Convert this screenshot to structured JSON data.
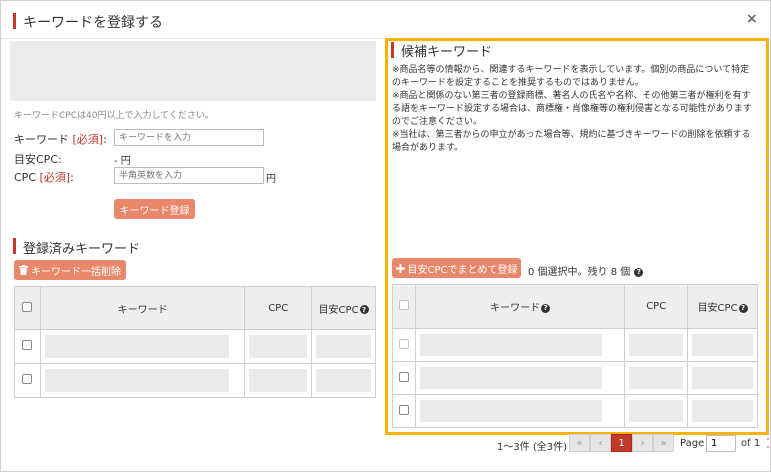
{
  "dialog": {
    "title": "キーワードを登録する",
    "close_glyph": "×"
  },
  "register_form": {
    "hint": "キーワードCPCは40円以上で入力してください。",
    "keyword_label": "キーワード",
    "keyword_required": "[必須]",
    "keyword_colon": ":",
    "keyword_placeholder": "キーワードを入力",
    "target_cpc_label": "目安CPC:",
    "target_cpc_value": "- 円",
    "cpc_label": "CPC",
    "cpc_required": "[必須]",
    "cpc_colon": ":",
    "cpc_placeholder": "半角英数を入力",
    "cpc_unit": "円",
    "submit_label": "キーワード登録"
  },
  "registered": {
    "title": "登録済みキーワード",
    "bulk_delete_label": "キーワード一括削除",
    "columns": {
      "keyword": "キーワード",
      "cpc": "CPC",
      "target_cpc": "目安CPC"
    },
    "rows": [
      {},
      {}
    ]
  },
  "candidates": {
    "title": "候補キーワード",
    "notices": [
      "※商品名等の情報から、関連するキーワードを表示しています。個別の商品について特定のキーワードを設定することを推奨するものではありません。",
      "※商品と関係のない第三者の登録商標、著名人の氏名や名称、その他第三者が権利を有する語をキーワード設定する場合は、商標権・肖像権等の権利侵害となる可能性がありますのでご注意ください。",
      "※当社は、第三者からの申立があった場合等、規約に基づきキーワードの削除を依頼する場合があります。"
    ],
    "bulk_register_label": "目安CPCでまとめて登録",
    "selection_info": "0 個選択中。残り 8 個",
    "columns": {
      "keyword": "キーワード",
      "cpc": "CPC",
      "target_cpc": "目安CPC"
    },
    "rows": [
      {},
      {},
      {}
    ]
  },
  "pagination": {
    "range_text": "1〜3件 (全3件)",
    "first": "«",
    "prev": "‹",
    "current": "1",
    "next": "›",
    "last": "»",
    "page_label": "Page",
    "page_value": "1",
    "of_text": "of 1"
  },
  "colors": {
    "accent_red": "#c0392b",
    "button_orange": "#e8876a",
    "highlight_yellow": "#f5b400"
  },
  "icons": {
    "close": "close-icon",
    "trash": "trash-icon",
    "plus": "plus-icon",
    "help": "help-icon"
  }
}
